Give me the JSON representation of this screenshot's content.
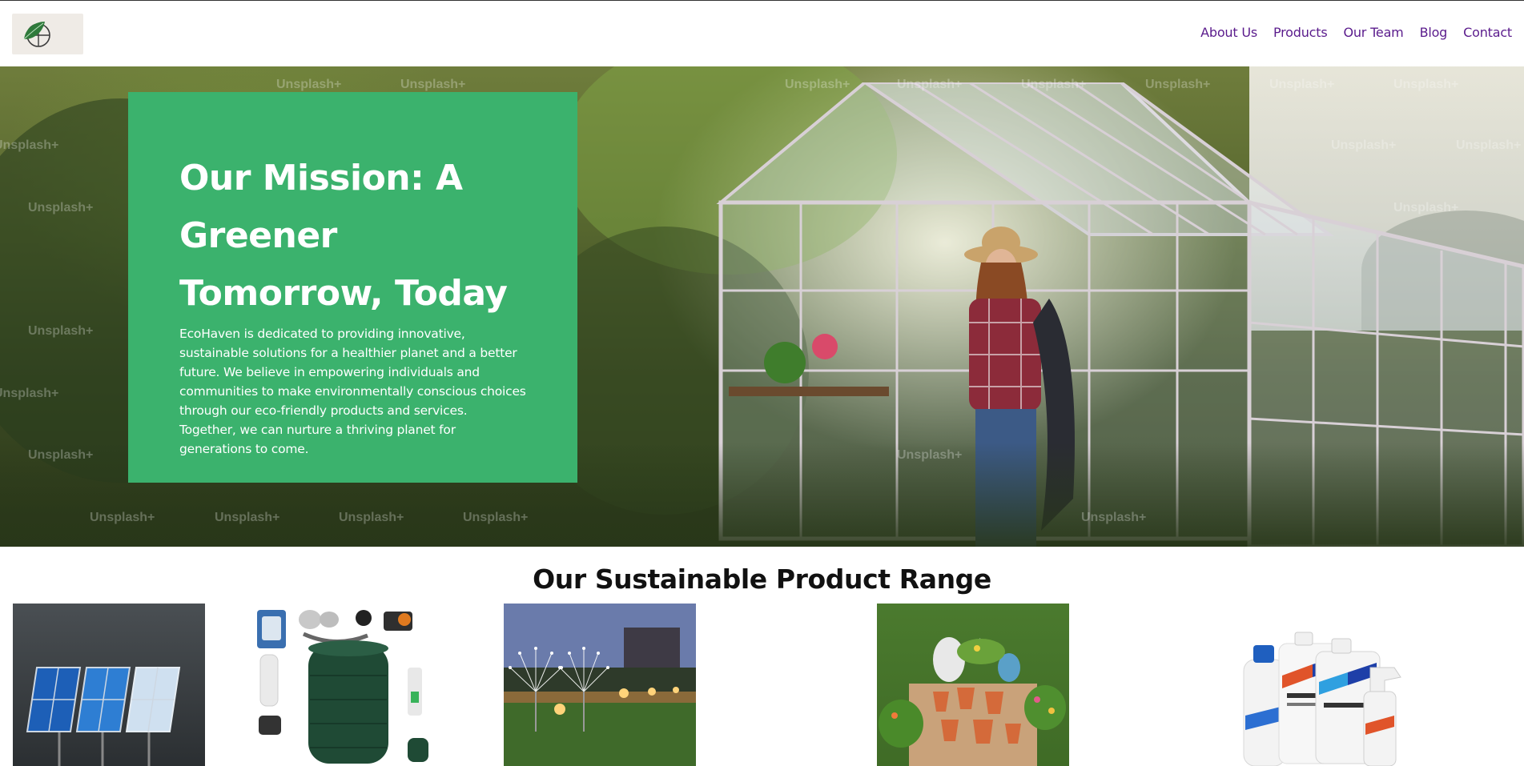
{
  "header": {
    "logo": {
      "icon": "leaf-globe-icon",
      "alt": "EcoHaven logo"
    },
    "nav": [
      {
        "label": "About Us"
      },
      {
        "label": "Products"
      },
      {
        "label": "Our Team"
      },
      {
        "label": "Blog"
      },
      {
        "label": "Contact"
      }
    ],
    "nav_color": "#5a1b8c"
  },
  "hero": {
    "image": "woman-leaving-greenhouse-photo",
    "watermark_text": "Unsplash+",
    "mission_title": "Our Mission: A Greener Tomorrow, Today",
    "mission_text": "EcoHaven is dedicated to providing innovative, sustainable solutions for a healthier planet and a better future. We believe in empowering individuals and communities to make environmentally conscious choices through our eco-friendly products and services. Together, we can nurture a thriving planet for generations to come.",
    "panel_color": "#3bb26d"
  },
  "products": {
    "title": "Our Sustainable Product Range",
    "items": [
      {
        "image": "solar-panels-photo"
      },
      {
        "image": "rainwater-tank-kit-photo"
      },
      {
        "image": "solar-garden-lights-photo"
      },
      {
        "image": "terracotta-pots-and-watering-cans-photo"
      },
      {
        "image": "eco-cleaning-bottles-photo"
      }
    ]
  }
}
